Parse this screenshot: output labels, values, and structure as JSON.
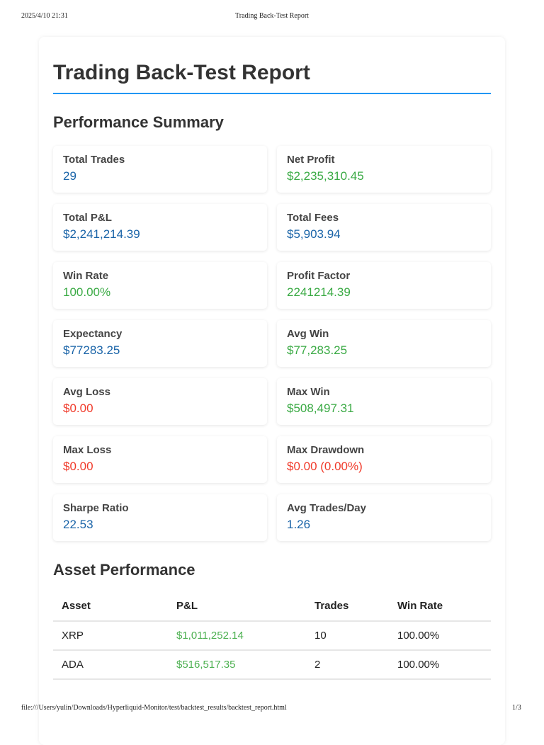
{
  "print_header": {
    "datetime": "2025/4/10 21:31",
    "title": "Trading Back-Test Report"
  },
  "print_footer": {
    "path": "file:///Users/yulin/Downloads/Hyperliquid-Monitor/test/backtest_results/backtest_report.html",
    "page": "1/3"
  },
  "title": "Trading Back-Test Report",
  "summary": {
    "heading": "Performance Summary",
    "metrics": [
      {
        "label": "Total Trades",
        "value": "29",
        "color": "blue"
      },
      {
        "label": "Net Profit",
        "value": "$2,235,310.45",
        "color": "green"
      },
      {
        "label": "Total P&L",
        "value": "$2,241,214.39",
        "color": "blue"
      },
      {
        "label": "Total Fees",
        "value": "$5,903.94",
        "color": "blue"
      },
      {
        "label": "Win Rate",
        "value": "100.00%",
        "color": "green"
      },
      {
        "label": "Profit Factor",
        "value": "2241214.39",
        "color": "green"
      },
      {
        "label": "Expectancy",
        "value": "$77283.25",
        "color": "blue"
      },
      {
        "label": "Avg Win",
        "value": "$77,283.25",
        "color": "green"
      },
      {
        "label": "Avg Loss",
        "value": "$0.00",
        "color": "red"
      },
      {
        "label": "Max Win",
        "value": "$508,497.31",
        "color": "green"
      },
      {
        "label": "Max Loss",
        "value": "$0.00",
        "color": "red"
      },
      {
        "label": "Max Drawdown",
        "value": "$0.00 (0.00%)",
        "color": "red"
      },
      {
        "label": "Sharpe Ratio",
        "value": "22.53",
        "color": "blue"
      },
      {
        "label": "Avg Trades/Day",
        "value": "1.26",
        "color": "blue"
      }
    ]
  },
  "assets": {
    "heading": "Asset Performance",
    "columns": [
      "Asset",
      "P&L",
      "Trades",
      "Win Rate"
    ],
    "rows": [
      {
        "asset": "XRP",
        "pnl": "$1,011,252.14",
        "trades": "10",
        "win_rate": "100.00%"
      },
      {
        "asset": "ADA",
        "pnl": "$516,517.35",
        "trades": "2",
        "win_rate": "100.00%"
      }
    ]
  }
}
